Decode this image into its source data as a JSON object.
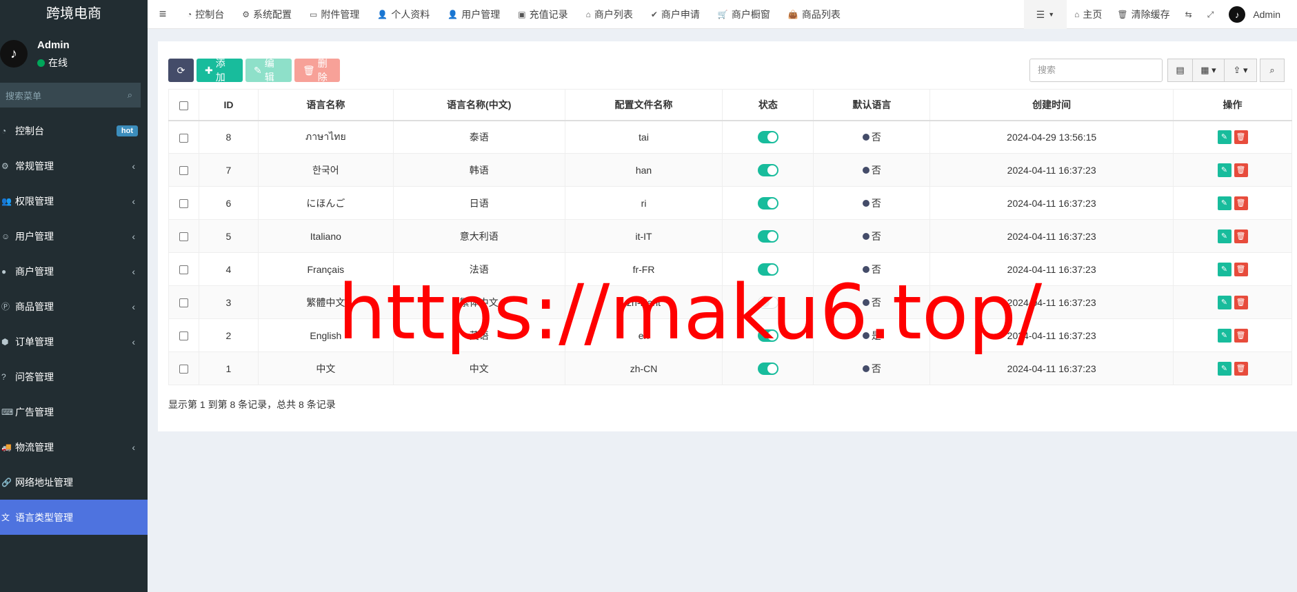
{
  "sidebar": {
    "logo": "跨境电商",
    "user": {
      "name": "Admin",
      "status": "在线"
    },
    "search_placeholder": "搜索菜单",
    "items": [
      {
        "icon": "dashboard-icon",
        "label": "控制台",
        "badge": "hot",
        "has_children": false,
        "active": false
      },
      {
        "icon": "cogs-icon",
        "label": "常规管理",
        "has_children": true,
        "active": false
      },
      {
        "icon": "group-icon",
        "label": "权限管理",
        "has_children": true,
        "active": false
      },
      {
        "icon": "user-circle-icon",
        "label": "用户管理",
        "has_children": true,
        "active": false
      },
      {
        "icon": "apple-icon",
        "label": "商户管理",
        "has_children": true,
        "active": false
      },
      {
        "icon": "product-icon",
        "label": "商品管理",
        "has_children": true,
        "active": false
      },
      {
        "icon": "cube-icon",
        "label": "订单管理",
        "has_children": true,
        "active": false
      },
      {
        "icon": "question-icon",
        "label": "问答管理",
        "has_children": false,
        "active": false
      },
      {
        "icon": "keyboard-icon",
        "label": "广告管理",
        "has_children": false,
        "active": false
      },
      {
        "icon": "truck-icon",
        "label": "物流管理",
        "has_children": true,
        "active": false
      },
      {
        "icon": "link-icon",
        "label": "网络地址管理",
        "has_children": false,
        "active": false
      },
      {
        "icon": "language-icon",
        "label": "语言类型管理",
        "has_children": false,
        "active": true
      }
    ]
  },
  "navbar": {
    "tabs": [
      {
        "icon": "dashboard-icon",
        "label": "控制台"
      },
      {
        "icon": "gear-icon",
        "label": "系统配置"
      },
      {
        "icon": "file-icon",
        "label": "附件管理"
      },
      {
        "icon": "user-icon",
        "label": "个人资料"
      },
      {
        "icon": "user-icon",
        "label": "用户管理"
      },
      {
        "icon": "money-icon",
        "label": "充值记录"
      },
      {
        "icon": "home-icon",
        "label": "商户列表"
      },
      {
        "icon": "check-circle-icon",
        "label": "商户申请"
      },
      {
        "icon": "cart-icon",
        "label": "商户橱窗"
      },
      {
        "icon": "shopping-bag-icon",
        "label": "商品列表"
      }
    ],
    "right": {
      "home_label": "主页",
      "clear_cache_label": "清除缓存",
      "admin_label": "Admin"
    }
  },
  "toolbar": {
    "add_label": "添加",
    "edit_label": "编辑",
    "delete_label": "删除",
    "search_placeholder": "搜索"
  },
  "table": {
    "headers": [
      "ID",
      "语言名称",
      "语言名称(中文)",
      "配置文件名称",
      "状态",
      "默认语言",
      "创建时间",
      "操作"
    ],
    "rows": [
      {
        "id": "8",
        "name": "ภาษาไทย",
        "name_cn": "泰语",
        "file": "tai",
        "status": true,
        "default": "否",
        "created": "2024-04-29 13:56:15"
      },
      {
        "id": "7",
        "name": "한국어",
        "name_cn": "韩语",
        "file": "han",
        "status": true,
        "default": "否",
        "created": "2024-04-11 16:37:23"
      },
      {
        "id": "6",
        "name": "にほんご",
        "name_cn": "日语",
        "file": "ri",
        "status": true,
        "default": "否",
        "created": "2024-04-11 16:37:23"
      },
      {
        "id": "5",
        "name": "Italiano",
        "name_cn": "意大利语",
        "file": "it-IT",
        "status": true,
        "default": "否",
        "created": "2024-04-11 16:37:23"
      },
      {
        "id": "4",
        "name": "Français",
        "name_cn": "法语",
        "file": "fr-FR",
        "status": true,
        "default": "否",
        "created": "2024-04-11 16:37:23"
      },
      {
        "id": "3",
        "name": "繁體中文",
        "name_cn": "繁体中文",
        "file": "zh-Hant",
        "status": false,
        "default": "否",
        "created": "2024-04-11 16:37:23"
      },
      {
        "id": "2",
        "name": "English",
        "name_cn": "英语",
        "file": "en",
        "status": true,
        "default": "是",
        "created": "2024-04-11 16:37:23"
      },
      {
        "id": "1",
        "name": "中文",
        "name_cn": "中文",
        "file": "zh-CN",
        "status": true,
        "default": "否",
        "created": "2024-04-11 16:37:23"
      }
    ]
  },
  "footer_info": "显示第 1 到第 8 条记录，总共 8 条记录",
  "watermark": "https://maku6.top/",
  "colors": {
    "sidebar_bg": "#222d32",
    "active_item": "#4e73df",
    "primary_green": "#18bc9c",
    "danger_red": "#e74c3c",
    "watermark_red": "#ff0000"
  }
}
